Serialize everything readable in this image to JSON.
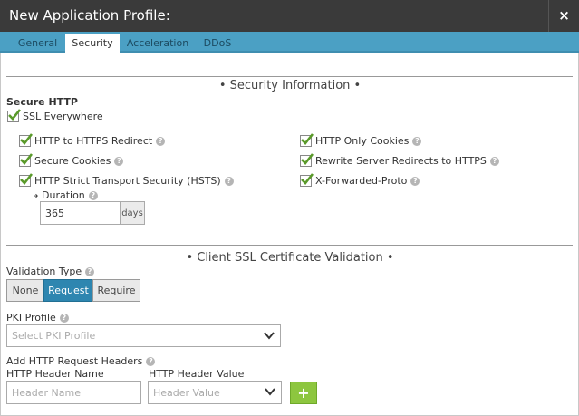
{
  "window": {
    "title": "New Application Profile:",
    "close_label": "×"
  },
  "tabs": [
    {
      "label": "General"
    },
    {
      "label": "Security"
    },
    {
      "label": "Acceleration"
    },
    {
      "label": "DDoS"
    }
  ],
  "security_info": {
    "title": "• Security Information •",
    "secure_http_label": "Secure HTTP",
    "ssl_everywhere": "SSL Everywhere",
    "options_left": [
      "HTTP to HTTPS Redirect",
      "Secure Cookies",
      "HTTP Strict Transport Security (HSTS)"
    ],
    "options_right": [
      "HTTP Only Cookies",
      "Rewrite Server Redirects to HTTPS",
      "X-Forwarded-Proto"
    ],
    "duration_label": "Duration",
    "duration_value": "365",
    "duration_unit": "days"
  },
  "client_ssl": {
    "title": "• Client SSL Certificate Validation •",
    "validation_type_label": "Validation Type",
    "validation_options": [
      "None",
      "Request",
      "Require"
    ],
    "selected": "Request",
    "pki_label": "PKI Profile",
    "pki_placeholder": "Select PKI Profile",
    "headers_label": "Add HTTP Request Headers",
    "header_name_label": "HTTP Header Name",
    "header_name_placeholder": "Header Name",
    "header_value_label": "HTTP Header Value",
    "header_value_placeholder": "Header Value",
    "add_label": "+"
  },
  "icons": {
    "close": "close-icon",
    "check": "checkmark-icon",
    "help": "question-icon",
    "chevron": "chevron-down-icon",
    "arrow": "return-arrow-icon"
  },
  "colors": {
    "titlebar": "#3a3a3a",
    "tabbar": "#4ba0c4",
    "active_segment": "#2e86b0",
    "check_green": "#5a9a2a",
    "add_button": "#8dc63f"
  }
}
